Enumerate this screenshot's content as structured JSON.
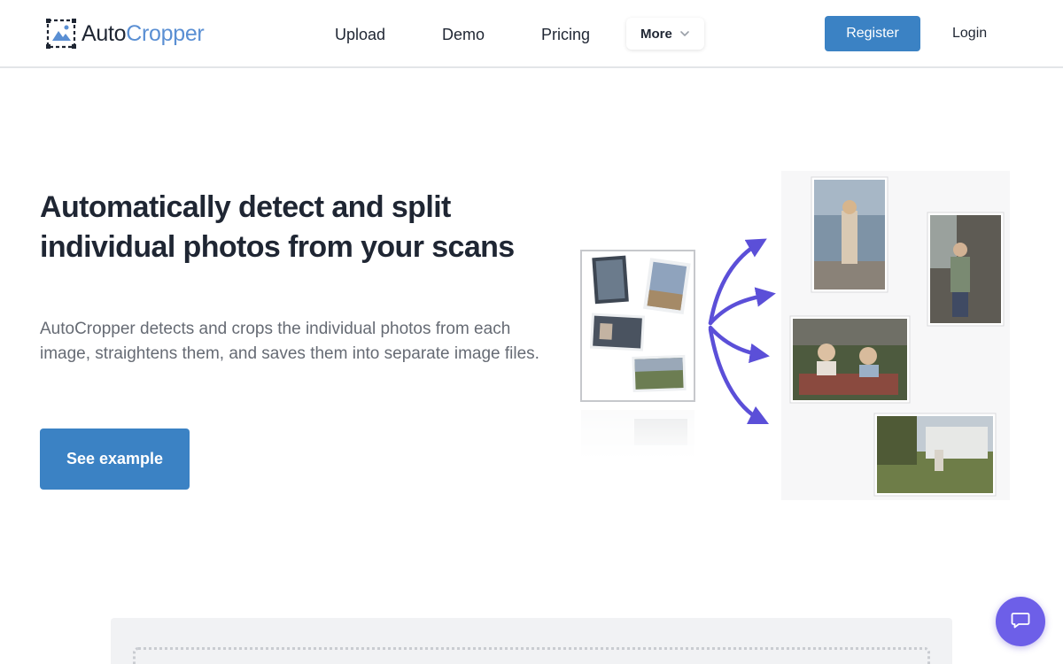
{
  "brand": {
    "name_part1": "Auto",
    "name_part2": "Cropper",
    "accent": "#5a8fd3"
  },
  "nav": {
    "items": [
      {
        "label": "Upload"
      },
      {
        "label": "Demo"
      },
      {
        "label": "Pricing"
      }
    ],
    "more_label": "More"
  },
  "auth": {
    "register_label": "Register",
    "login_label": "Login"
  },
  "hero": {
    "title": "Automatically detect and split individual photos from your scans",
    "description": "AutoCropper detects and crops the individual photos from each image, straightens them, and saves them into separate image files.",
    "cta_label": "See example"
  },
  "icons": {
    "logo": "crop-mountain-icon",
    "more_chevron": "chevron-down-icon",
    "chat": "chat-bubble-icon"
  },
  "colors": {
    "primary_button": "#3b82c4",
    "chat_button": "#6d5fe8",
    "arrow": "#5b4fd8"
  }
}
